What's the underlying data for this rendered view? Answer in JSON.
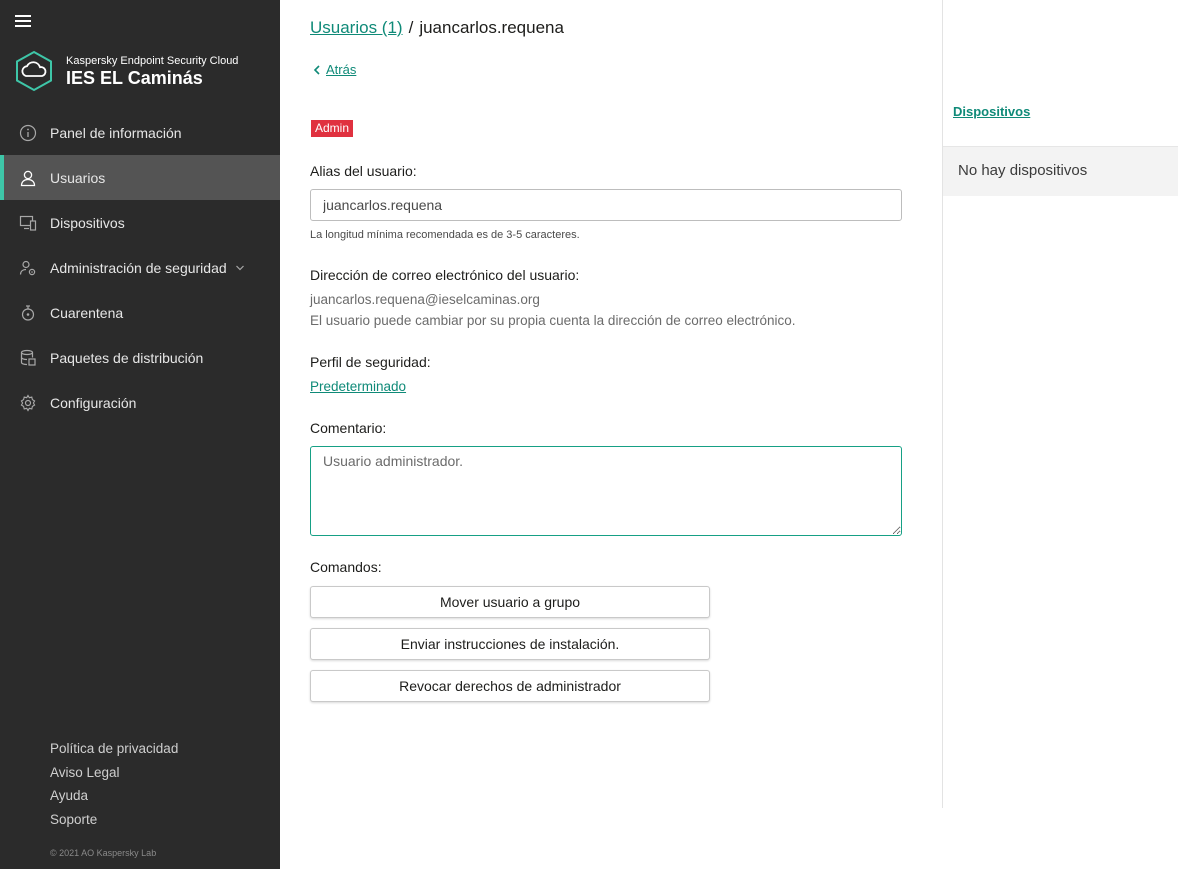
{
  "sidebar": {
    "product": "Kaspersky Endpoint Security Cloud",
    "organization": "IES EL Caminás",
    "items": [
      {
        "label": "Panel de información",
        "icon": "info-icon"
      },
      {
        "label": "Usuarios",
        "icon": "user-icon",
        "active": true
      },
      {
        "label": "Dispositivos",
        "icon": "devices-icon"
      },
      {
        "label": "Administración de seguridad",
        "icon": "security-management-icon",
        "has_submenu": true
      },
      {
        "label": "Cuarentena",
        "icon": "quarantine-icon"
      },
      {
        "label": "Paquetes de distribución",
        "icon": "packages-icon"
      },
      {
        "label": "Configuración",
        "icon": "gear-icon"
      }
    ],
    "footer_links": [
      "Política de privacidad",
      "Aviso Legal",
      "Ayuda",
      "Soporte"
    ],
    "copyright": "© 2021 AO Kaspersky Lab"
  },
  "header": {
    "breadcrumb_link": "Usuarios (1)",
    "separator": "/",
    "current": "juancarlos.requena",
    "back_label": "Atrás"
  },
  "user": {
    "role_badge": "Admin",
    "alias_label": "Alias del usuario:",
    "alias_value": "juancarlos.requena",
    "alias_hint": "La longitud mínima recomendada es de 3-5 caracteres.",
    "email_label": "Dirección de correo electrónico del usuario:",
    "email_value": "juancarlos.requena@ieselcaminas.org",
    "email_note": "El usuario puede cambiar por su propia cuenta la dirección de correo electrónico.",
    "profile_label": "Perfil de seguridad:",
    "profile_value": "Predeterminado",
    "comment_label": "Comentario:",
    "comment_value": "Usuario administrador.",
    "commands_label": "Comandos:",
    "commands": [
      "Mover usuario a grupo",
      "Enviar instrucciones de instalación.",
      "Revocar derechos de administrador"
    ]
  },
  "devices_panel": {
    "tab_label": "Dispositivos",
    "empty_text": "No hay dispositivos"
  },
  "colors": {
    "sidebar_bg": "#2b2b2b",
    "accent": "#0f8a78",
    "active_marker": "#3ec6a8",
    "badge_red": "#e0313f"
  }
}
